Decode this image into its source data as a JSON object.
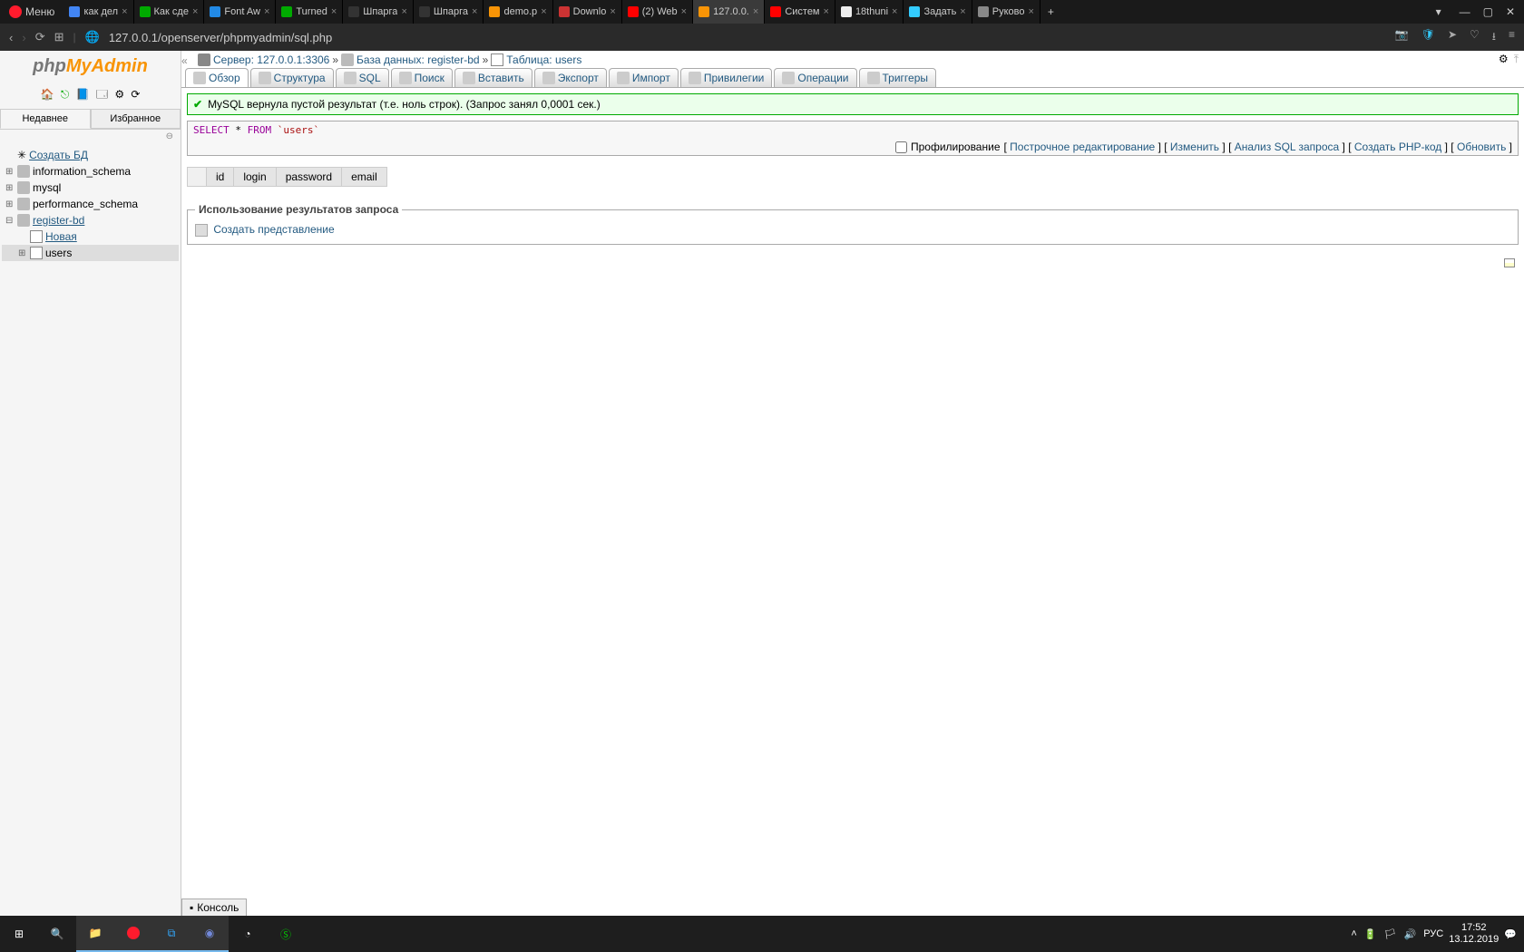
{
  "browser": {
    "menu_label": "Меню",
    "tabs": [
      {
        "title": "как дел",
        "active": false,
        "favcolor": "#4285f4"
      },
      {
        "title": "Как сде",
        "active": false,
        "favcolor": "#0a0"
      },
      {
        "title": "Font Aw",
        "active": false,
        "favcolor": "#228ae6"
      },
      {
        "title": "Turned",
        "active": false,
        "favcolor": "#0a0"
      },
      {
        "title": "Шпарга",
        "active": false,
        "favcolor": "#333"
      },
      {
        "title": "Шпарга",
        "active": false,
        "favcolor": "#333"
      },
      {
        "title": "demo.p",
        "active": false,
        "favcolor": "#f89406"
      },
      {
        "title": "Downlo",
        "active": false,
        "favcolor": "#c33"
      },
      {
        "title": "(2) Web",
        "active": false,
        "favcolor": "#f00"
      },
      {
        "title": "127.0.0.",
        "active": true,
        "favcolor": "#f89406"
      },
      {
        "title": "Систем",
        "active": false,
        "favcolor": "#f00"
      },
      {
        "title": "18thuni",
        "active": false,
        "favcolor": "#eee"
      },
      {
        "title": "Задать",
        "active": false,
        "favcolor": "#3cf"
      },
      {
        "title": "Руково",
        "active": false,
        "favcolor": "#888"
      }
    ],
    "url": "127.0.0.1/openserver/phpmyadmin/sql.php"
  },
  "sidebar": {
    "recent_label": "Недавнее",
    "favorite_label": "Избранное",
    "tree": {
      "create_db": "Создать БД",
      "dbs": [
        "information_schema",
        "mysql",
        "performance_schema"
      ],
      "open_db": "register-bd",
      "new_table": "Новая",
      "table": "users"
    }
  },
  "breadcrumb": {
    "server_label": "Сервер:",
    "server_value": "127.0.0.1:3306",
    "db_label": "База данных:",
    "db_value": "register-bd",
    "table_label": "Таблица:",
    "table_value": "users"
  },
  "tabs": [
    {
      "label": "Обзор",
      "active": true
    },
    {
      "label": "Структура",
      "active": false
    },
    {
      "label": "SQL",
      "active": false
    },
    {
      "label": "Поиск",
      "active": false
    },
    {
      "label": "Вставить",
      "active": false
    },
    {
      "label": "Экспорт",
      "active": false
    },
    {
      "label": "Импорт",
      "active": false
    },
    {
      "label": "Привилегии",
      "active": false
    },
    {
      "label": "Операции",
      "active": false
    },
    {
      "label": "Триггеры",
      "active": false
    }
  ],
  "notice": "MySQL вернула пустой результат (т.е. ноль строк). (Запрос занял 0,0001 сек.)",
  "sql": {
    "display": "SELECT * FROM `users`",
    "profiling_label": "Профилирование",
    "actions": [
      "Построчное редактирование",
      "Изменить",
      "Анализ SQL запроса",
      "Создать PHP-код",
      "Обновить"
    ]
  },
  "columns": [
    "id",
    "login",
    "password",
    "email"
  ],
  "fieldset": {
    "legend": "Использование результатов запроса",
    "create_view": "Создать представление"
  },
  "console_label": "Консоль",
  "taskbar": {
    "lang": "РУС",
    "time": "17:52",
    "date": "13.12.2019"
  }
}
